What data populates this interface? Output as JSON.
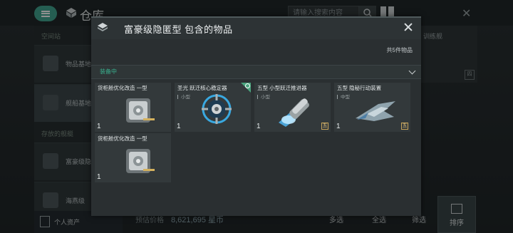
{
  "background": {
    "title": "仓库",
    "search_placeholder": "请输入搜索内容",
    "left_sections": [
      "空间站",
      "存放的舰艇"
    ],
    "left_items": [
      "物品基地",
      "舰船基地",
      "富豪级隐",
      "海燕级"
    ],
    "footer_label": "个人资产",
    "credit_label": "预估价格",
    "credit_value": "8,621,695 星币",
    "right_label": "训练舰",
    "right_tier": "四",
    "bottom_buttons": [
      "多选",
      "全选",
      "筛选"
    ],
    "sort_label": "排序"
  },
  "modal": {
    "title": "富豪级隐匿型 包含的物品",
    "item_count": "共5件物品",
    "group_label": "装备中",
    "items": [
      {
        "name": "货柜舱优化改造 一型",
        "size": "",
        "qty": "1",
        "tier": "",
        "art": "cargo-module"
      },
      {
        "name": "圣光 跃迁核心稳定器",
        "size": "小型",
        "qty": "1",
        "tier": "",
        "art": "warp-core-stabilizer",
        "flag": true
      },
      {
        "name": "五型 小型跃迁推进器",
        "size": "小型",
        "qty": "1",
        "tier": "五",
        "art": "warp-thruster"
      },
      {
        "name": "五型 隐秘行动装置",
        "size": "中型",
        "qty": "1",
        "tier": "五",
        "art": "covert-ops-device"
      },
      {
        "name": "货柜舱优化改造 一型",
        "size": "",
        "qty": "1",
        "tier": "",
        "art": "cargo-module"
      }
    ]
  },
  "colors": {
    "accent": "#3fa58f",
    "group_label": "#39b08e",
    "tier_gold": "#e3c27c"
  }
}
